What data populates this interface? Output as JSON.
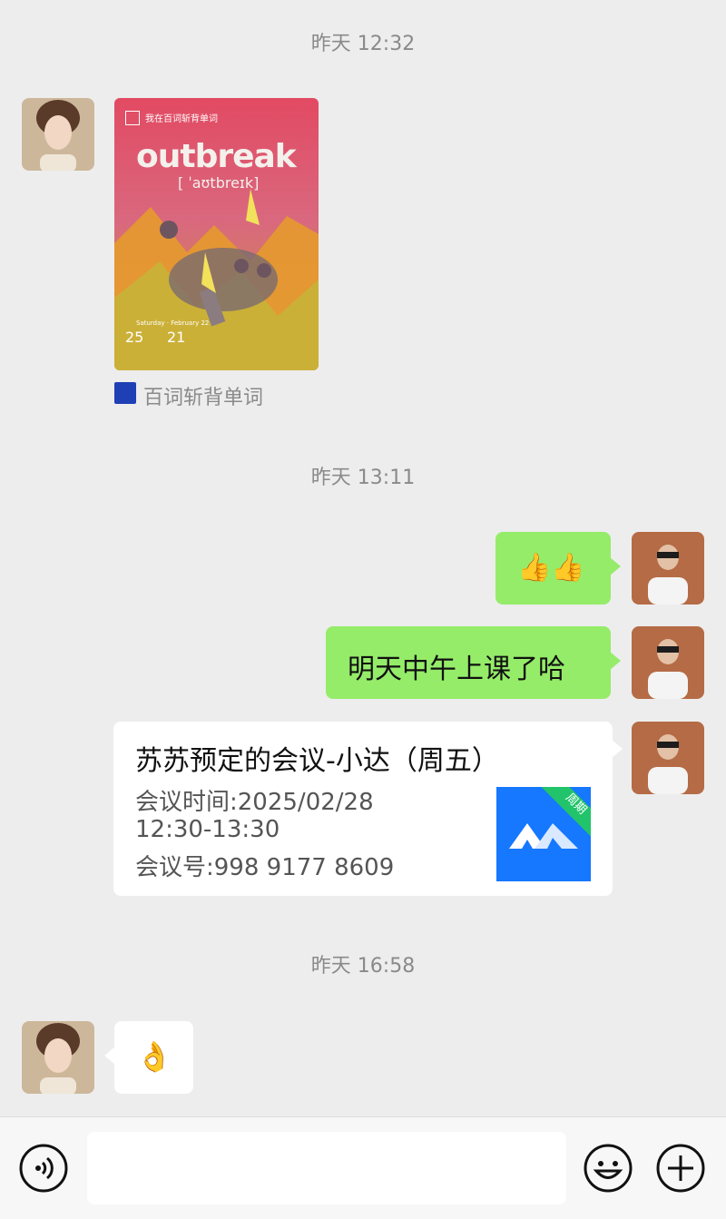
{
  "timestamps": [
    "昨天 12:32",
    "昨天 13:11",
    "昨天 16:58"
  ],
  "share_card": {
    "header_small": "我在百词斩背单词",
    "word": "outbreak",
    "phonetic": "[ ˈaʊtbreɪk]",
    "date_small": "Saturday · February 22",
    "stat1": "25",
    "stat2": "21",
    "source_name": "百词斩背单词"
  },
  "messages": {
    "thumbs": "👍👍",
    "text1": "明天中午上课了哈",
    "ok": "👌"
  },
  "meeting_card": {
    "title": "苏苏预定的会议-小达（周五）",
    "time_label": "会议时间:2025/02/28",
    "time_range": "12:30-13:30",
    "meeting_id": "会议号:998 9177 8609",
    "badge": "周期"
  },
  "colors": {
    "background": "#ededed",
    "self_bubble": "#95ec69",
    "meeting_blue": "#1677ff"
  },
  "icons": [
    "voice-icon",
    "emoji-icon",
    "plus-icon"
  ]
}
